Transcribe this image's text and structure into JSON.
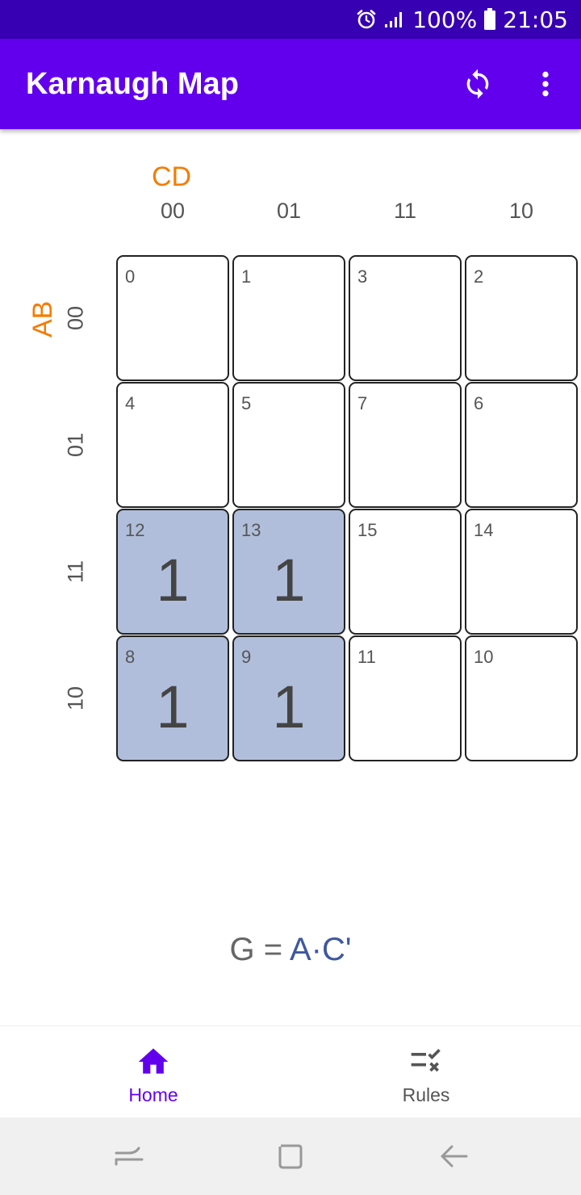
{
  "status_bar": {
    "battery": "100%",
    "time": "21:05",
    "icons": [
      "alarm-icon",
      "signal-icon",
      "battery-icon"
    ]
  },
  "app_bar": {
    "title": "Karnaugh Map",
    "actions": [
      "refresh-icon",
      "more-vert-icon"
    ],
    "color": "#6200ee"
  },
  "kmap": {
    "col_var": "CD",
    "row_var": "AB",
    "col_codes": [
      "00",
      "01",
      "11",
      "10"
    ],
    "row_codes": [
      "00",
      "01",
      "11",
      "10"
    ],
    "rows": [
      [
        {
          "index": "0",
          "value": ""
        },
        {
          "index": "1",
          "value": ""
        },
        {
          "index": "3",
          "value": ""
        },
        {
          "index": "2",
          "value": ""
        }
      ],
      [
        {
          "index": "4",
          "value": ""
        },
        {
          "index": "5",
          "value": ""
        },
        {
          "index": "7",
          "value": ""
        },
        {
          "index": "6",
          "value": ""
        }
      ],
      [
        {
          "index": "12",
          "value": "1"
        },
        {
          "index": "13",
          "value": "1"
        },
        {
          "index": "15",
          "value": ""
        },
        {
          "index": "14",
          "value": ""
        }
      ],
      [
        {
          "index": "8",
          "value": "1"
        },
        {
          "index": "9",
          "value": "1"
        },
        {
          "index": "11",
          "value": ""
        },
        {
          "index": "10",
          "value": ""
        }
      ]
    ],
    "highlight_color": "#b1bedb"
  },
  "result": {
    "lhs": "G = ",
    "rhs": "A·C'"
  },
  "bottom_nav": {
    "items": [
      {
        "label": "Home",
        "icon": "home-icon",
        "active": true
      },
      {
        "label": "Rules",
        "icon": "rules-icon",
        "active": false
      }
    ]
  },
  "system_nav": {
    "buttons": [
      "recents-icon",
      "home-button-icon",
      "back-icon"
    ]
  }
}
